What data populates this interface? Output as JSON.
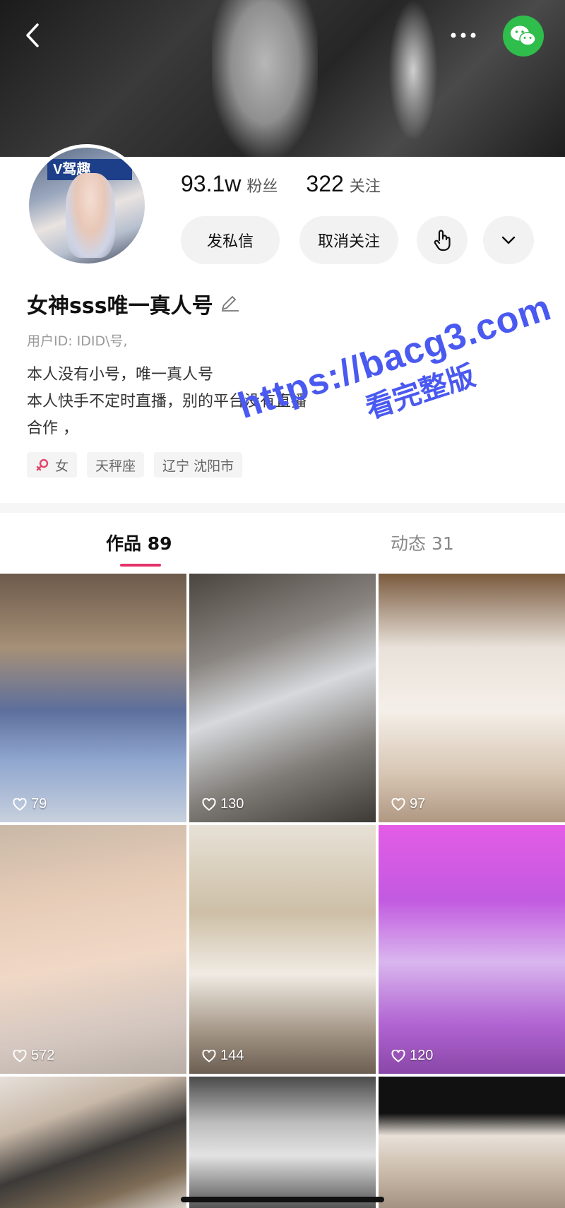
{
  "profile": {
    "fans_count": "93.1w",
    "fans_label": "粉丝",
    "following_count": "322",
    "following_label": "关注",
    "avatar_badge_text": "V驾趣",
    "name": "女神sss唯一真人号",
    "user_id": "用户ID: IDID\\号,",
    "bio_lines": [
      "本人没有小号，唯一真人号",
      "本人快手不定时直播，别的平台没有直播",
      "合作          ，"
    ],
    "tags": [
      {
        "icon": "female-icon",
        "label": "女"
      },
      {
        "label": "天秤座"
      },
      {
        "label": "辽宁 沈阳市"
      }
    ]
  },
  "actions": {
    "message_label": "发私信",
    "unfollow_label": "取消关注",
    "icons": [
      "tap-icon",
      "chevron-down-icon"
    ]
  },
  "header": {
    "icons": [
      "back-icon",
      "more-icon",
      "wechat-icon"
    ],
    "wechat_color": "#2fbd4b"
  },
  "watermark": {
    "line1": "https://bacg3.com",
    "line2": "看完整版",
    "color": "#4a59f0"
  },
  "tabs": [
    {
      "label": "作品 89",
      "active": true
    },
    {
      "label": "动态 31",
      "active": false
    }
  ],
  "accent_color": "#e5336a",
  "works": [
    {
      "likes": "79"
    },
    {
      "likes": "130"
    },
    {
      "likes": "97"
    },
    {
      "likes": "572"
    },
    {
      "likes": "144"
    },
    {
      "likes": "120"
    },
    {
      "likes": ""
    },
    {
      "likes": ""
    },
    {
      "likes": ""
    }
  ]
}
